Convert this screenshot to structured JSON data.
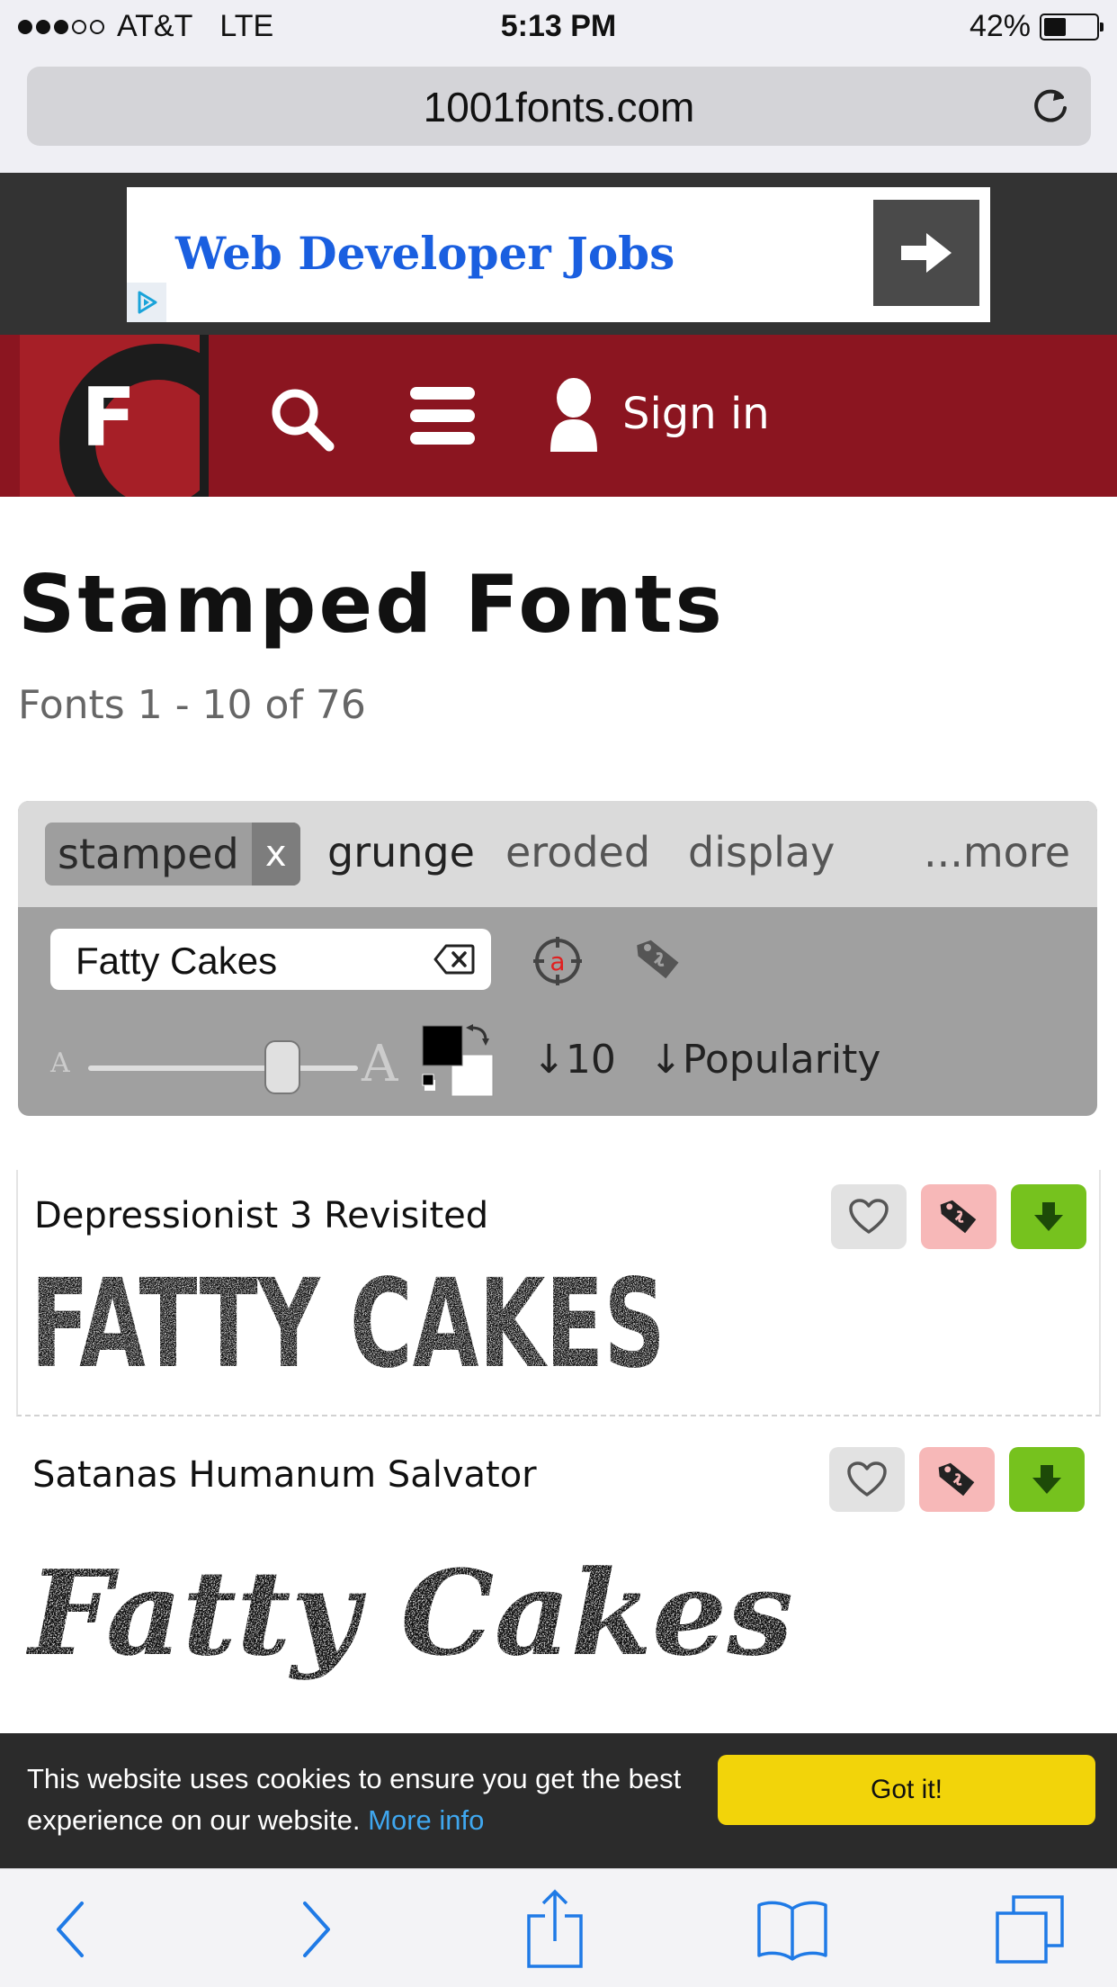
{
  "status_bar": {
    "carrier": "AT&T",
    "network": "LTE",
    "time": "5:13 PM",
    "battery_percent": "42%",
    "battery_level": 0.42,
    "signal_bars": 3,
    "signal_total": 5
  },
  "browser": {
    "url": "1001fonts.com"
  },
  "ad": {
    "headline": "Web Developer Jobs"
  },
  "header": {
    "logo_letter": "F",
    "sign_in": "Sign in"
  },
  "page": {
    "title": "Stamped Fonts",
    "subtitle": "Fonts 1 - 10 of 76"
  },
  "filters": {
    "active_tag": "stamped",
    "active_tag_remove": "x",
    "tags": [
      "grunge",
      "eroded",
      "display"
    ],
    "more": "...more",
    "search_value": "Fatty Cakes",
    "char_icon_letter": "a",
    "per_page": "10",
    "sort_by": "Popularity",
    "slider_small_glyph": "A",
    "slider_large_glyph": "A",
    "slider_level": 0.72
  },
  "fonts": [
    {
      "name": "Depressionist 3 Revisited",
      "preview_text": "FATTY CAKES"
    },
    {
      "name": "Satanas Humanum Salvator",
      "preview_text": "Fatty Cakes"
    }
  ],
  "cookie": {
    "message": "This website uses cookies to ensure you get the best experience on our website.",
    "link": "More info",
    "button": "Got it!"
  },
  "colors": {
    "header_red": "#8b1520",
    "accent_blue": "#1a5fe0",
    "download_green": "#76c21e",
    "cookie_yellow": "#f2d40a",
    "ios_blue": "#1f7ae6"
  }
}
